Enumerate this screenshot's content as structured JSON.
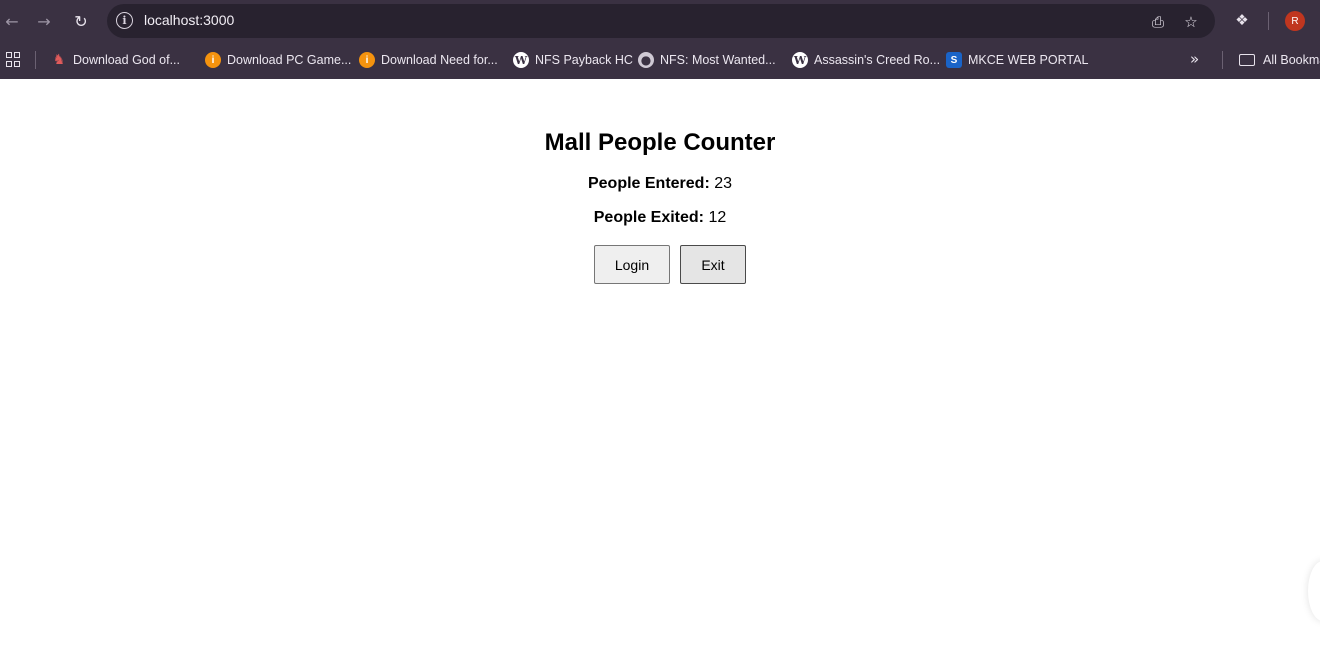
{
  "browser": {
    "url": "localhost:3000",
    "profile_initial": "R",
    "bookmarks": [
      {
        "label": "Download God of...",
        "icon": "game-icon"
      },
      {
        "label": "Download PC Game...",
        "icon": "orange-i-icon"
      },
      {
        "label": "Download Need for...",
        "icon": "orange-i-icon"
      },
      {
        "label": "NFS Payback HC",
        "icon": "wordpress-icon"
      },
      {
        "label": "NFS: Most Wanted...",
        "icon": "globe-icon"
      },
      {
        "label": "Assassin's Creed Ro...",
        "icon": "wordpress-icon"
      },
      {
        "label": "MKCE WEB PORTAL",
        "icon": "s-logo-icon"
      }
    ],
    "all_bookmarks_label": "All Bookma",
    "colors": {
      "chrome": "#3a3142",
      "omnibox": "#28222f",
      "avatar": "#c0361f"
    }
  },
  "page": {
    "title": "Mall People Counter",
    "entered_label": "People Entered:",
    "entered_value": "23",
    "exited_label": "People Exited:",
    "exited_value": "12",
    "login_button": "Login",
    "exit_button": "Exit"
  }
}
